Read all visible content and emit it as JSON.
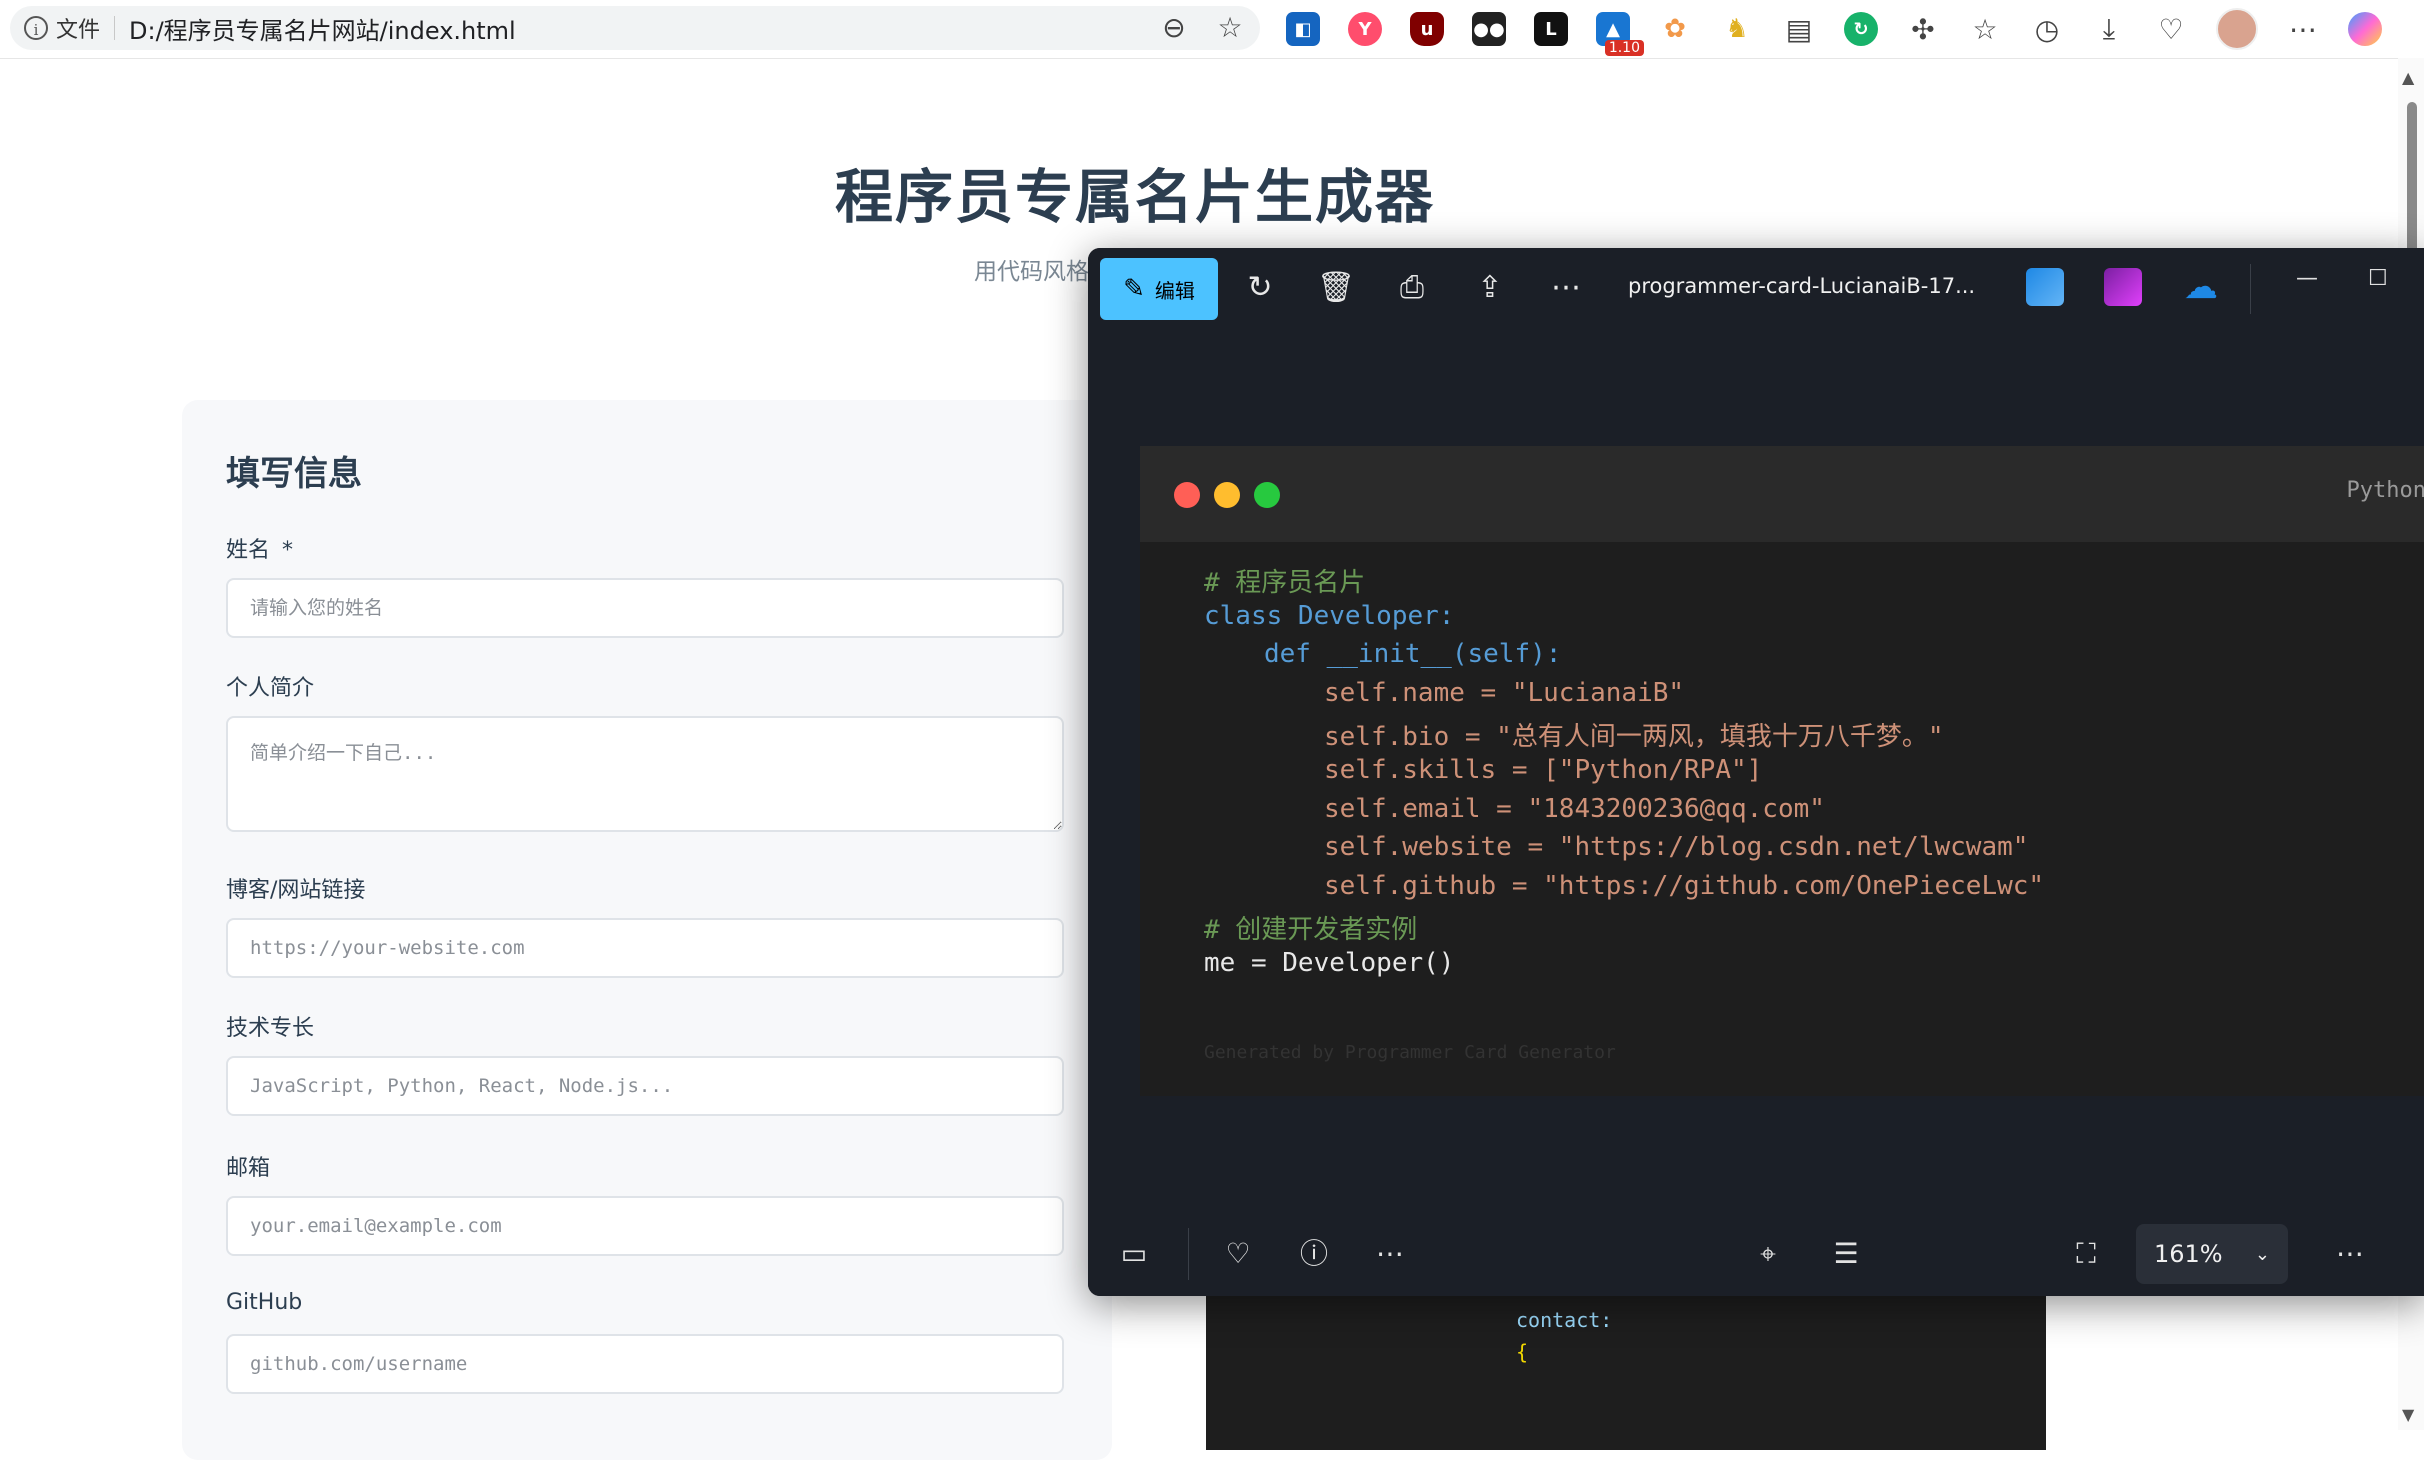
{
  "browser": {
    "info_chip": "文件",
    "url": "D:/程序员专属名片网站/index.html",
    "ext_badge": "1.10"
  },
  "page": {
    "title": "程序员专属名片生成器",
    "subtitle_visible": "用代码风格"
  },
  "form": {
    "title": "填写信息",
    "fields": [
      {
        "label": "姓名",
        "required_mark": "*",
        "placeholder": "请输入您的姓名"
      },
      {
        "label": "个人简介",
        "placeholder": "简单介绍一下自己..."
      },
      {
        "label": "博客/网站链接",
        "placeholder": "https://your-website.com"
      },
      {
        "label": "技术专长",
        "placeholder": "JavaScript, Python, React, Node.js..."
      },
      {
        "label": "邮箱",
        "placeholder": "your.email@example.com"
      },
      {
        "label": "GitHub",
        "placeholder": "github.com/username"
      }
    ]
  },
  "behind_preview": {
    "key": "contact:",
    "brace": "{"
  },
  "viewer": {
    "edit_label": "编辑",
    "filename": "programmer-card-LucianaiB-17...",
    "zoom": "161%",
    "card": {
      "lang": "Python",
      "lines": [
        {
          "text": "# 程序员名片",
          "cls": "c-comment",
          "indent": 0
        },
        {
          "text": "class Developer:",
          "cls": "c-kw",
          "indent": 0
        },
        {
          "text": "def __init__(self):",
          "cls": "c-kw",
          "indent": 1
        },
        {
          "text": "self.name = \"LucianaiB\"",
          "cls": "c-str",
          "indent": 2
        },
        {
          "text": "self.bio = \"总有人间一两风，填我十万八千梦。\"",
          "cls": "c-str",
          "indent": 2
        },
        {
          "text": "self.skills = [\"Python/RPA\"]",
          "cls": "c-str",
          "indent": 2
        },
        {
          "text": "self.email = \"1843200236@qq.com\"",
          "cls": "c-str",
          "indent": 2
        },
        {
          "text": "self.website = \"https://blog.csdn.net/lwcwam\"",
          "cls": "c-str",
          "indent": 2
        },
        {
          "text": "self.github = \"https://github.com/OnePieceLwc\"",
          "cls": "c-str",
          "indent": 2
        },
        {
          "text": "# 创建开发者实例",
          "cls": "c-comment",
          "indent": 0
        },
        {
          "text": "me = Developer()",
          "cls": "c-plain",
          "indent": 0
        }
      ],
      "footer": "Generated by Programmer Card Generator"
    }
  },
  "colors": {
    "accent": "#4cc2ff",
    "dot_red": "#ff5f56",
    "dot_yellow": "#ffbd2e",
    "dot_green": "#27c93f"
  }
}
